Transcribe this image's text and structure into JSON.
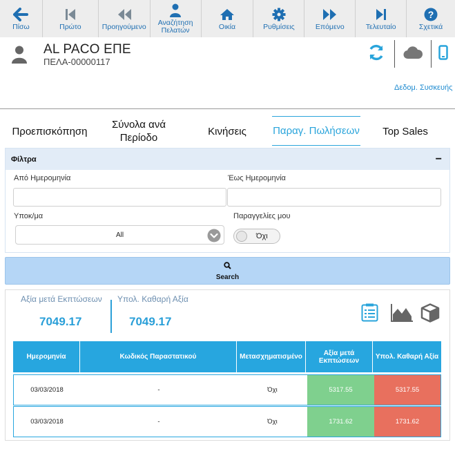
{
  "toolbar": {
    "back": "Πίσω",
    "first": "Πρώτο",
    "previous": "Προηγούμενο",
    "customer_search": "Αναζήτηση Πελατών",
    "home": "Οικία",
    "settings": "Ρυθμίσεις",
    "next": "Επόμενο",
    "last": "Τελευταίο",
    "about": "Σχετικά"
  },
  "header": {
    "name": "AL PACO ΕΠΕ",
    "code": "ΠΕΛΑ-00000117",
    "device_data_link": "Δεδομ. Συσκευής"
  },
  "tabs": {
    "overview": "Προεπισκόπηση",
    "totals_period": "Σύνολα ανά Περίοδο",
    "movements": "Κινήσεις",
    "sales_docs": "Παραγ. Πωλήσεων",
    "top_sales": "Top Sales"
  },
  "filters": {
    "title": "Φίλτρα",
    "collapse": "−",
    "from_date_label": "Από Ημερομηνία",
    "from_date_value": "",
    "to_date_label": "Έως Ημερομηνία",
    "to_date_value": "",
    "branch_label": "Υποκ/μα",
    "branch_value": "All",
    "my_orders_label": "Παραγγελίες μου",
    "my_orders_value": "Όχι"
  },
  "search": {
    "label": "Search"
  },
  "kpis": {
    "net_after_discount_label": "Αξία μετά Εκπτώσεων",
    "net_after_discount_value": "7049.17",
    "calc_net_value_label": "Υπολ. Καθαρή Αξία",
    "calc_net_value_value": "7049.17"
  },
  "table": {
    "headers": [
      "Ημερομηνία",
      "Κωδικός Παραστατικού",
      "Μετασχηματισμένο",
      "Αξία μετά Εκπτώσεων",
      "Υπολ. Καθαρή Αξία"
    ],
    "rows": [
      {
        "date": "03/03/2018",
        "doc_code": "-",
        "transformed": "Όχι",
        "value_after_discount": "5317.55",
        "calc_net_value": "5317.55"
      },
      {
        "date": "03/03/2018",
        "doc_code": "-",
        "transformed": "Όχι",
        "value_after_discount": "1731.62",
        "calc_net_value": "1731.62"
      }
    ]
  },
  "colors": {
    "accent": "#27a6df",
    "toolbar_text": "#1f6fb2",
    "green_cell": "#7fd08e",
    "red_cell": "#e8705e",
    "filters_header_bg": "#e2ecf7",
    "search_bg": "#b5d6f6"
  },
  "icons": {
    "back": "arrow-left-icon",
    "first": "skip-first-icon",
    "previous": "rewind-icon",
    "customer_search": "user-icon",
    "home": "home-icon",
    "settings": "gear-icon",
    "next": "fast-forward-icon",
    "last": "skip-last-icon",
    "about": "question-icon"
  }
}
